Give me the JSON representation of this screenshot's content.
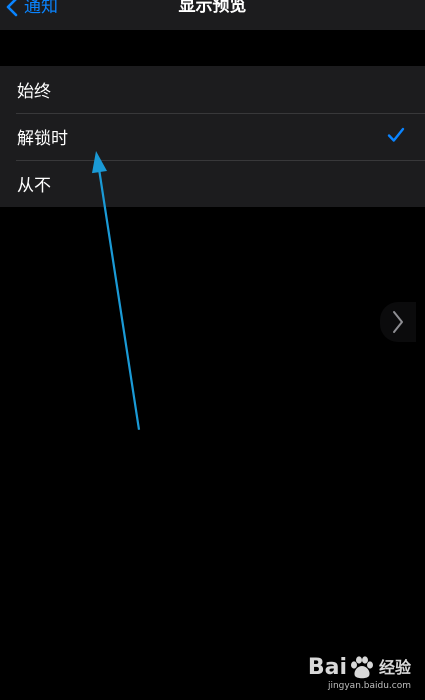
{
  "navbar": {
    "back_label": "通知",
    "title": "显示预览"
  },
  "options": [
    {
      "label": "始终",
      "selected": false
    },
    {
      "label": "解锁时",
      "selected": true
    },
    {
      "label": "从不",
      "selected": false
    }
  ],
  "watermark": {
    "brand_left": "Bai",
    "brand_right": "经验",
    "url": "jingyan.baidu.com"
  },
  "colors": {
    "accent": "#0a84ff",
    "background": "#000000",
    "group_background": "#1c1c1e",
    "separator": "#38383a",
    "annotation_arrow": "#1a9ad6"
  },
  "icons": {
    "back": "chevron-left-icon",
    "selected": "checkmark-icon",
    "side_panel": "chevron-right-icon",
    "watermark_logo": "paw-icon"
  }
}
